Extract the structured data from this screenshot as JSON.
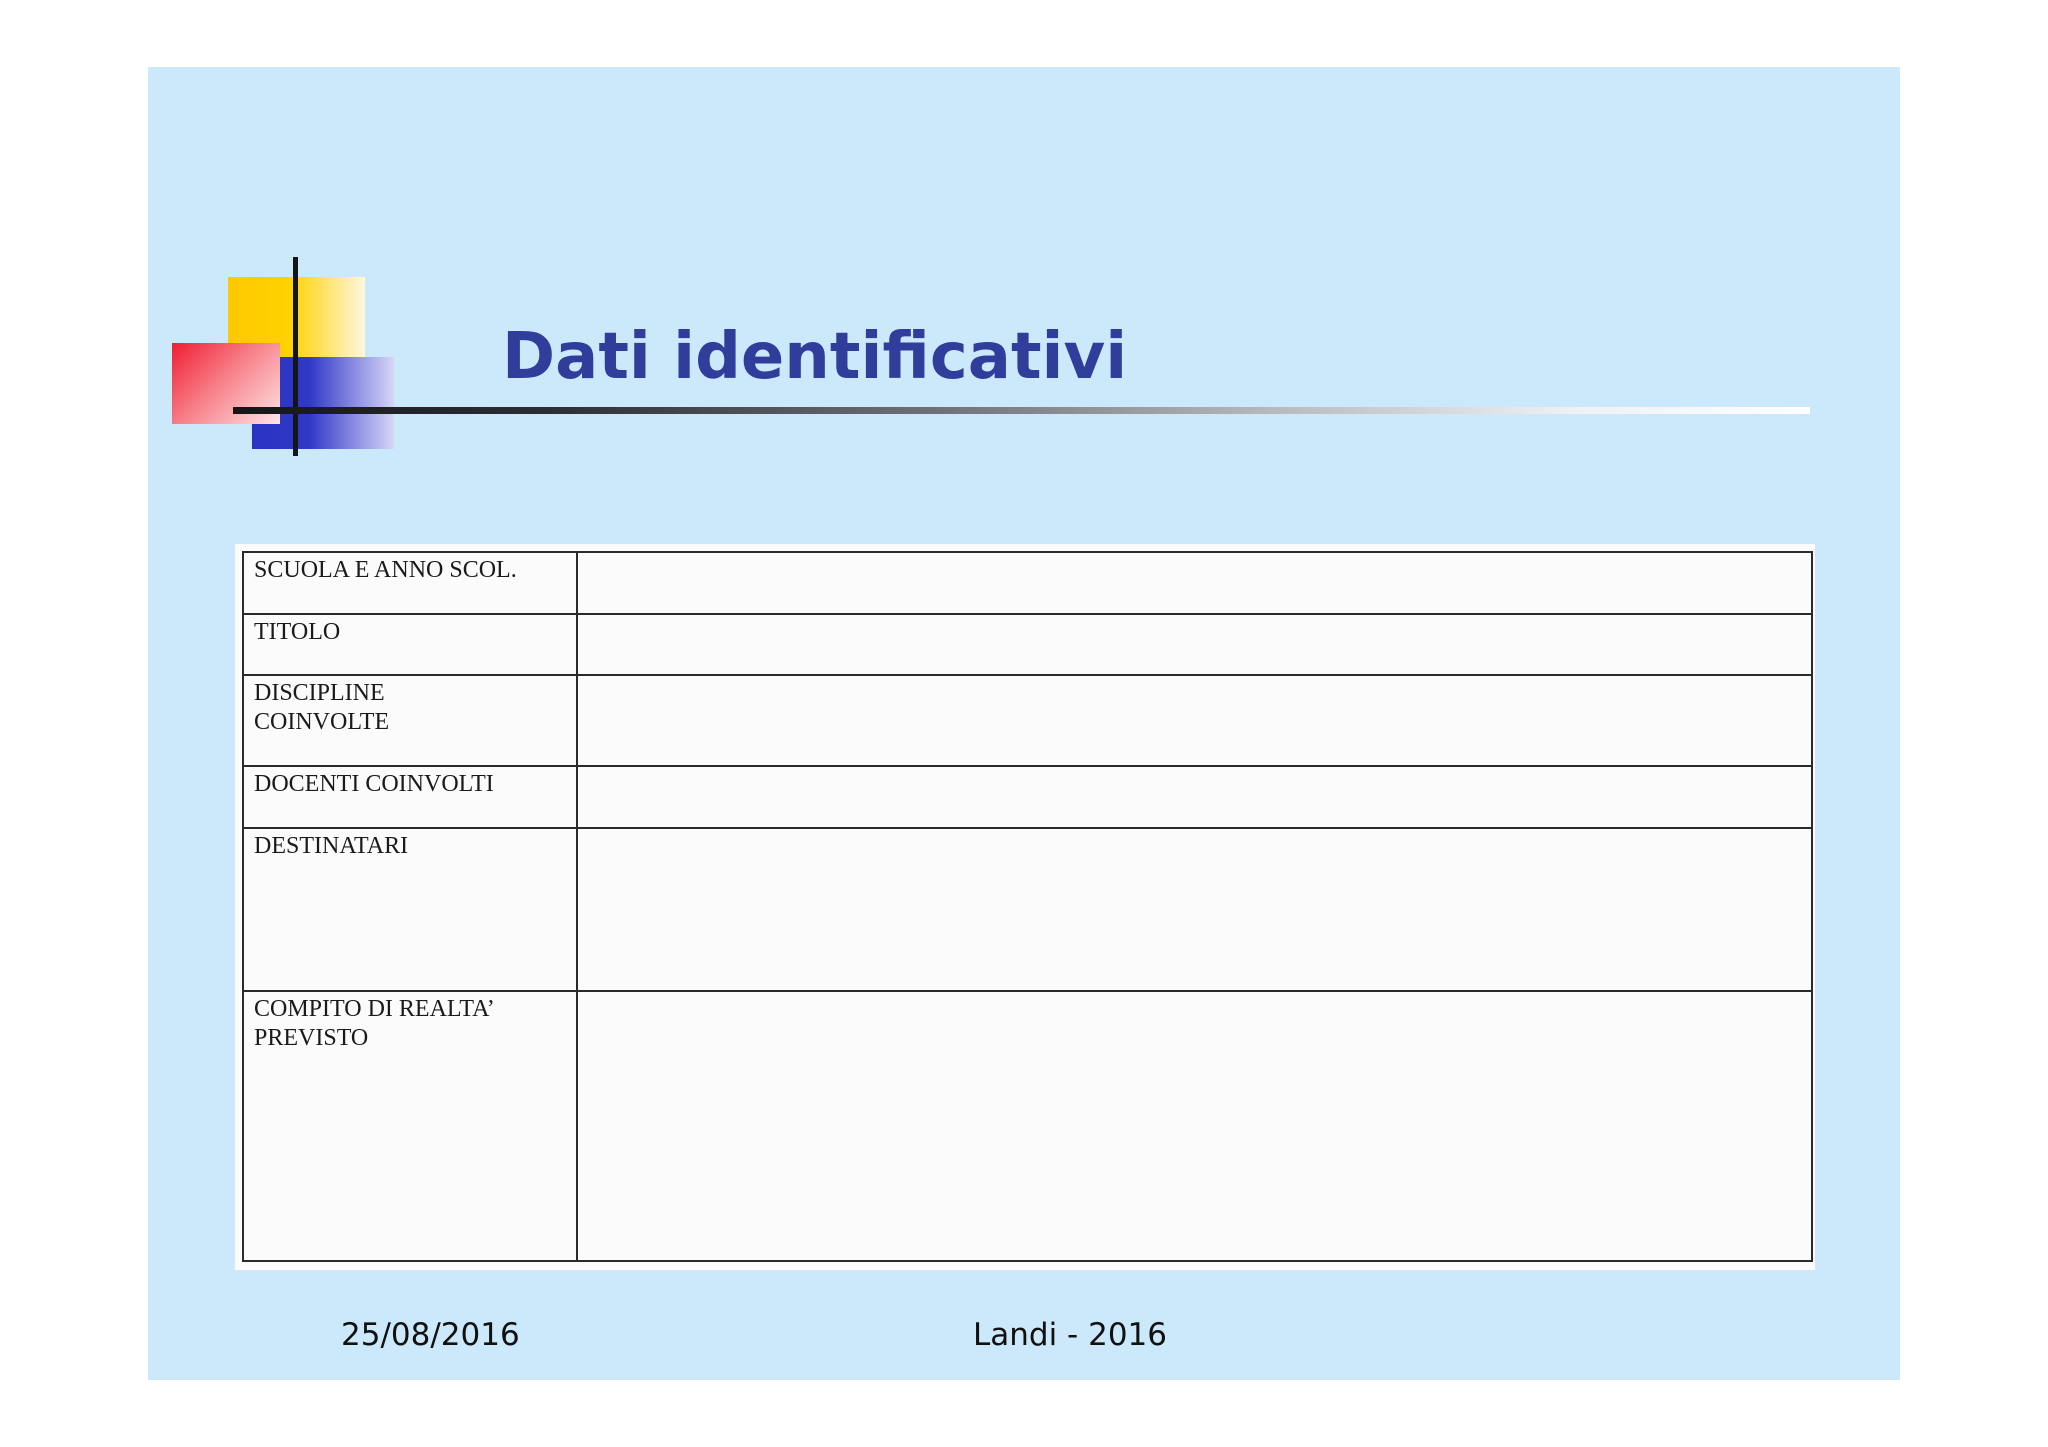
{
  "slide": {
    "title": "Dati identificativi"
  },
  "form": {
    "rows": [
      {
        "label_lines": [
          "SCUOLA  E ANNO SCOL."
        ],
        "value": ""
      },
      {
        "label_lines": [
          "TITOLO"
        ],
        "value": ""
      },
      {
        "label_lines": [
          "DISCIPLINE",
          "COINVOLTE"
        ],
        "value": ""
      },
      {
        "label_lines": [
          "DOCENTI  COINVOLTI"
        ],
        "value": ""
      },
      {
        "label_lines": [
          "DESTINATARI"
        ],
        "value": ""
      },
      {
        "label_lines": [
          "COMPITO  DI REALTA’",
          "PREVISTO"
        ],
        "value": ""
      }
    ]
  },
  "footer": {
    "date": "25/08/2016",
    "author": "Landi  -  2016"
  },
  "colors": {
    "slide_background": "#cce9fc",
    "title": "#303d9b",
    "logo_yellow": "#ffc800",
    "logo_blue": "#2a33c2",
    "logo_red": "#ef1e32"
  }
}
